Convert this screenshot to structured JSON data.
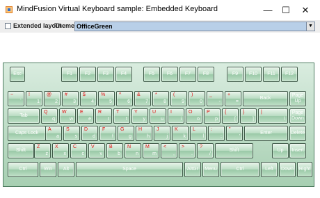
{
  "window": {
    "title": "MindFusion Virtual Keyboard sample: Embedded Keyboard",
    "minimize_glyph": "—",
    "maximize_glyph": "☐",
    "close_glyph": "✕"
  },
  "toolbar": {
    "extended_layout_label": "Extended layout",
    "extended_layout_checked": false,
    "theme_label": "Theme:",
    "theme_value": "OfficeGreen",
    "dropdown_glyph": "▼"
  },
  "colors": {
    "key_label": "#ffffff",
    "shift_label": "#e01010",
    "keyboard_bg": "#b7d9c0",
    "combo_bg": "#b8cfe8"
  },
  "keyboard": {
    "rows": [
      [
        {
          "name": "key-esc",
          "label": "Esc"
        },
        {
          "name": "key-f1",
          "label": "F1"
        },
        {
          "name": "key-f2",
          "label": "F2"
        },
        {
          "name": "key-f3",
          "label": "F3"
        },
        {
          "name": "key-f4",
          "label": "F4"
        },
        {
          "name": "key-f5",
          "label": "F5"
        },
        {
          "name": "key-f6",
          "label": "F6"
        },
        {
          "name": "key-f7",
          "label": "F7"
        },
        {
          "name": "key-f8",
          "label": "F8"
        },
        {
          "name": "key-f9",
          "label": "F9"
        },
        {
          "name": "key-f10",
          "label": "F10"
        },
        {
          "name": "key-f11",
          "label": "F11"
        },
        {
          "name": "key-f12",
          "label": "F12"
        }
      ],
      [
        {
          "name": "key-backtick",
          "shift": "~",
          "main": "`"
        },
        {
          "name": "key-1",
          "shift": "!",
          "main": "1"
        },
        {
          "name": "key-2",
          "shift": "@",
          "main": "2"
        },
        {
          "name": "key-3",
          "shift": "#",
          "main": "3"
        },
        {
          "name": "key-4",
          "shift": "$",
          "main": "4"
        },
        {
          "name": "key-5",
          "shift": "%",
          "main": "5"
        },
        {
          "name": "key-6",
          "shift": "^",
          "main": "6"
        },
        {
          "name": "key-7",
          "shift": "&",
          "main": "7"
        },
        {
          "name": "key-8",
          "shift": "*",
          "main": "8"
        },
        {
          "name": "key-9",
          "shift": "(",
          "main": "9"
        },
        {
          "name": "key-0",
          "shift": ")",
          "main": "0"
        },
        {
          "name": "key-minus",
          "shift": "_",
          "main": "-"
        },
        {
          "name": "key-equals",
          "shift": "+",
          "main": "="
        },
        {
          "name": "key-backspace",
          "label": "Back"
        },
        {
          "name": "key-page-up",
          "label": "Page\nUp"
        }
      ],
      [
        {
          "name": "key-tab",
          "label": "Tab"
        },
        {
          "name": "key-q",
          "shift": "Q",
          "main": "q"
        },
        {
          "name": "key-w",
          "shift": "W",
          "main": "w"
        },
        {
          "name": "key-e",
          "shift": "E",
          "main": "e"
        },
        {
          "name": "key-r",
          "shift": "R",
          "main": "r"
        },
        {
          "name": "key-t",
          "shift": "T",
          "main": "t"
        },
        {
          "name": "key-y",
          "shift": "Y",
          "main": "y"
        },
        {
          "name": "key-u",
          "shift": "U",
          "main": "u"
        },
        {
          "name": "key-i",
          "shift": "I",
          "main": "i"
        },
        {
          "name": "key-o",
          "shift": "O",
          "main": "o"
        },
        {
          "name": "key-p",
          "shift": "P",
          "main": "p"
        },
        {
          "name": "key-lbracket",
          "shift": "{",
          "main": "["
        },
        {
          "name": "key-rbracket",
          "shift": "}",
          "main": "]"
        },
        {
          "name": "key-backslash",
          "shift": "|",
          "main": "\\"
        },
        {
          "name": "key-page-down",
          "label": "Page\nDown"
        }
      ],
      [
        {
          "name": "key-caps-lock",
          "label": "Caps Lock"
        },
        {
          "name": "key-a",
          "shift": "A",
          "main": "a"
        },
        {
          "name": "key-s",
          "shift": "S",
          "main": "s"
        },
        {
          "name": "key-d",
          "shift": "D",
          "main": "d"
        },
        {
          "name": "key-f",
          "shift": "F",
          "main": "f"
        },
        {
          "name": "key-g",
          "shift": "G",
          "main": "g"
        },
        {
          "name": "key-h",
          "shift": "H",
          "main": "h"
        },
        {
          "name": "key-j",
          "shift": "J",
          "main": "j"
        },
        {
          "name": "key-k",
          "shift": "K",
          "main": "k"
        },
        {
          "name": "key-l",
          "shift": "L",
          "main": "l"
        },
        {
          "name": "key-semicolon",
          "shift": ":",
          "main": ";"
        },
        {
          "name": "key-quote",
          "shift": "\"",
          "main": "'"
        },
        {
          "name": "key-enter",
          "label": "Enter"
        },
        {
          "name": "key-delete",
          "label": "Delete"
        }
      ],
      [
        {
          "name": "key-left-shift",
          "label": "Shift"
        },
        {
          "name": "key-z",
          "shift": "Z",
          "main": "z"
        },
        {
          "name": "key-x",
          "shift": "X",
          "main": "x"
        },
        {
          "name": "key-c",
          "shift": "C",
          "main": "c"
        },
        {
          "name": "key-v",
          "shift": "V",
          "main": "v"
        },
        {
          "name": "key-b",
          "shift": "B",
          "main": "b"
        },
        {
          "name": "key-n",
          "shift": "N",
          "main": "n"
        },
        {
          "name": "key-m",
          "shift": "M",
          "main": "m"
        },
        {
          "name": "key-comma",
          "shift": "<",
          "main": ","
        },
        {
          "name": "key-period",
          "shift": ">",
          "main": "."
        },
        {
          "name": "key-slash",
          "shift": "?",
          "main": "/"
        },
        {
          "name": "key-right-shift",
          "label": "Shift"
        },
        {
          "name": "key-up",
          "label": "Up"
        },
        {
          "name": "key-insert",
          "label": "Insert"
        }
      ],
      [
        {
          "name": "key-left-ctrl",
          "label": "Ctrl"
        },
        {
          "name": "key-win",
          "label": "Win"
        },
        {
          "name": "key-alt",
          "label": "Alt"
        },
        {
          "name": "key-space",
          "label": "Space"
        },
        {
          "name": "key-altgr",
          "label": "AltGr"
        },
        {
          "name": "key-menu",
          "label": "Menu"
        },
        {
          "name": "key-right-ctrl",
          "label": "Ctrl"
        },
        {
          "name": "key-left",
          "label": "Left"
        },
        {
          "name": "key-down",
          "label": "Down"
        },
        {
          "name": "key-right",
          "label": "Right"
        }
      ]
    ]
  }
}
